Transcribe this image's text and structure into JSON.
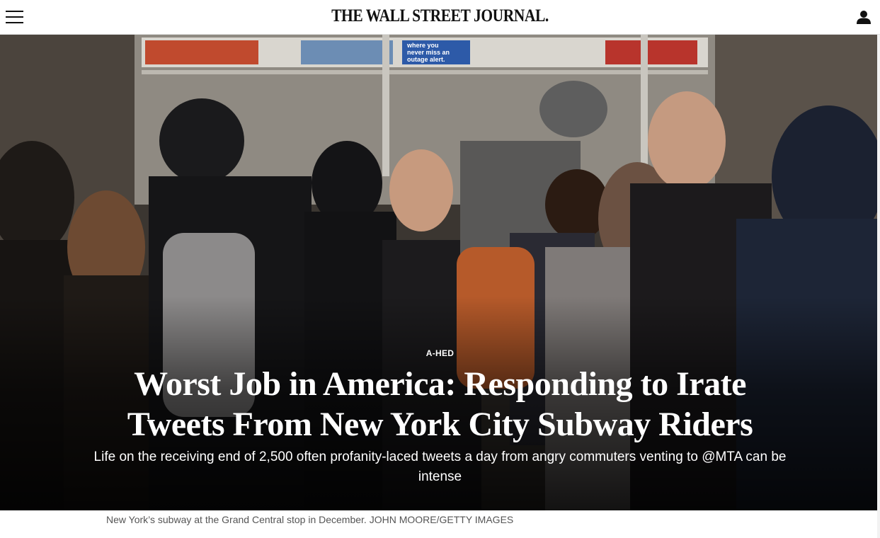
{
  "header": {
    "masthead": "THE WALL STREET JOURNAL.",
    "menu_icon": "hamburger-menu-icon",
    "user_icon": "user-account-icon"
  },
  "article": {
    "kicker": "A-HED",
    "headline": "Worst Job in America: Responding to Irate Tweets From New York City Subway Riders",
    "dek": "Life on the receiving end of 2,500 often profanity-laced tweets a day from angry commuters venting to @MTA can be intense",
    "caption": "New York’s subway at the Grand Central stop in December. JOHN MOORE/GETTY IMAGES"
  },
  "photo": {
    "description_icon": "subway-crowd-photo",
    "ad_text": "where you never miss an outage alert."
  },
  "colors": {
    "text_dark": "#111111",
    "caption_gray": "#555555",
    "overlay_text": "#ffffff"
  }
}
